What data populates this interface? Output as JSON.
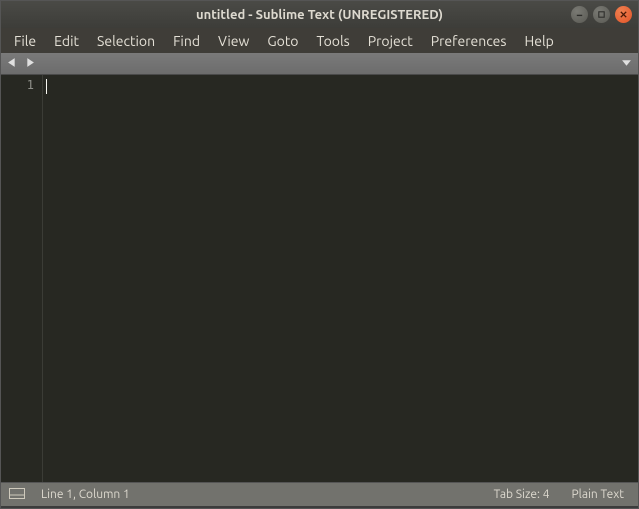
{
  "titlebar": {
    "title": "untitled - Sublime Text (UNREGISTERED)"
  },
  "menubar": {
    "items": [
      "File",
      "Edit",
      "Selection",
      "Find",
      "View",
      "Goto",
      "Tools",
      "Project",
      "Preferences",
      "Help"
    ]
  },
  "gutter": {
    "line1": "1"
  },
  "statusbar": {
    "position": "Line 1, Column 1",
    "tab_size": "Tab Size: 4",
    "syntax": "Plain Text"
  }
}
